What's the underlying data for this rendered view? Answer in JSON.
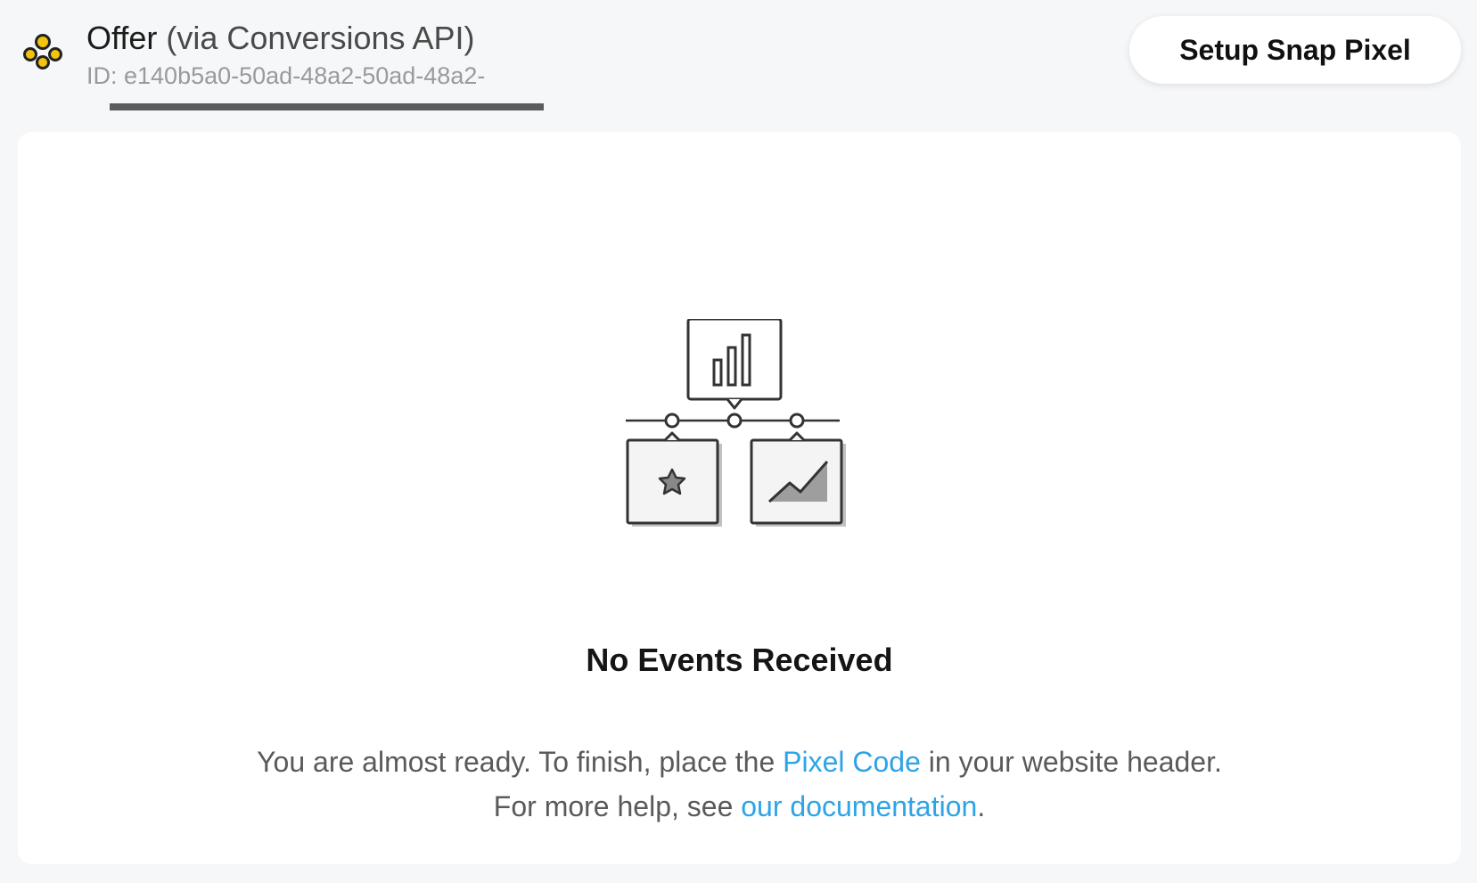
{
  "header": {
    "title_main": "Offer",
    "title_suffix": "(via Conversions API)",
    "id_text": "ID: e140b5a0-50ad-48a2-50ad-48a2-",
    "setup_button_label": "Setup Snap Pixel",
    "logo_icon": "pixel-circles-icon",
    "accent_color": "#f2c40f"
  },
  "empty_state": {
    "illustration_icon": "events-hierarchy-icon",
    "title": "No Events Received",
    "line1_before": "You are almost ready. To finish, place the ",
    "line1_link": "Pixel Code",
    "line1_after": " in your website header.",
    "line2_before": "For more help, see ",
    "line2_link": "our documentation",
    "line2_after": ".",
    "link_color": "#2ea4e6"
  }
}
